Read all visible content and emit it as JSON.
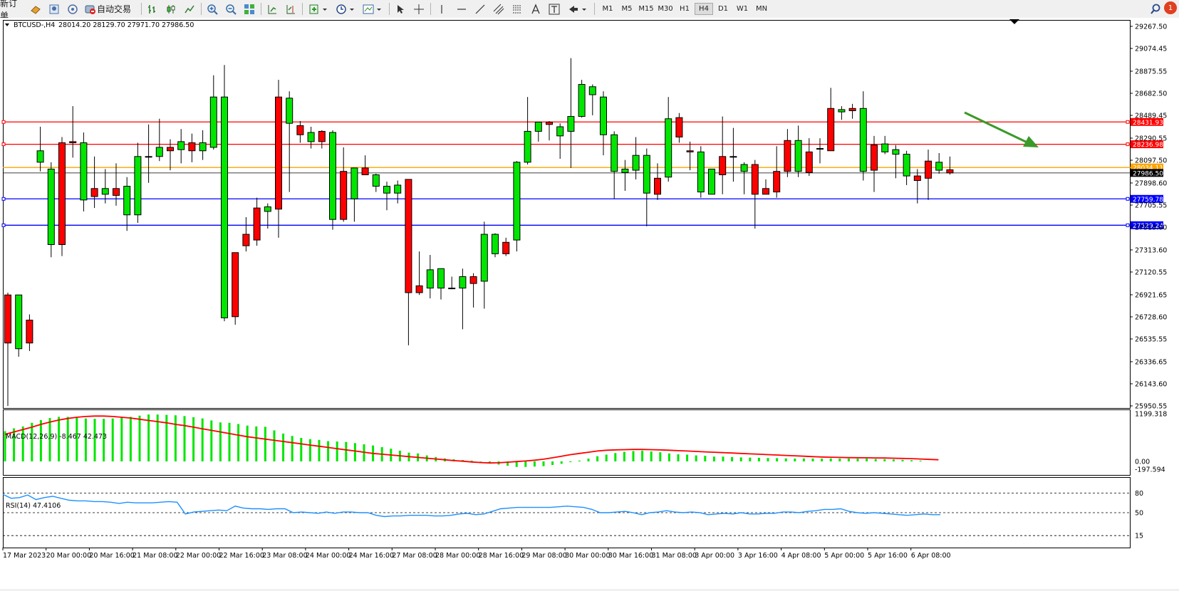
{
  "toolbar": {
    "new_order_label": "新订单",
    "auto_trading_label": "自动交易",
    "timeframes": [
      "M1",
      "M5",
      "M15",
      "M30",
      "H1",
      "H4",
      "D1",
      "W1",
      "MN"
    ],
    "active_timeframe": "H4",
    "notification_count": "1",
    "icons": [
      "new-order-icon",
      "metaeditor-icon",
      "market-watch-icon",
      "signals-icon",
      "auto-trading-icon",
      "bar-chart-icon",
      "candlestick-icon",
      "line-chart-icon",
      "zoom-in-icon",
      "zoom-out-icon",
      "tile-windows-icon",
      "auto-scroll-icon",
      "chart-shift-icon",
      "indicators-icon",
      "periods-icon",
      "templates-icon",
      "cursor-icon",
      "crosshair-icon",
      "vertical-line-icon",
      "horizontal-line-icon",
      "trendline-icon",
      "equidistant-channel-icon",
      "fibonacci-icon",
      "text-icon",
      "text-label-icon",
      "arrows-icon",
      "search-icon",
      "notifications-icon"
    ]
  },
  "chart": {
    "header": "BTCUSD-,H4",
    "ohlc": "28014.20 28129.70 27971.70 27986.50",
    "price_ticks": [
      "29267.50",
      "29074.45",
      "28875.55",
      "28682.50",
      "28489.45",
      "28290.55",
      "28097.50",
      "27898.60",
      "27705.55",
      "27513.00",
      "27313.60",
      "27120.55",
      "26921.65",
      "26728.60",
      "26535.55",
      "26336.65",
      "26143.60",
      "25950.55"
    ],
    "date_labels": [
      "17 Mar 2023",
      "20 Mar 00:00",
      "20 Mar 16:00",
      "21 Mar 08:00",
      "22 Mar 00:00",
      "22 Mar 16:00",
      "23 Mar 08:00",
      "24 Mar 00:00",
      "24 Mar 16:00",
      "27 Mar 08:00",
      "28 Mar 00:00",
      "28 Mar 16:00",
      "29 Mar 08:00",
      "30 Mar 00:00",
      "30 Mar 16:00",
      "31 Mar 08:00",
      "3 Apr 00:00",
      "3 Apr 16:00",
      "4 Apr 08:00",
      "5 Apr 00:00",
      "5 Apr 16:00",
      "6 Apr 08:00"
    ],
    "current_price": "27986.50",
    "levels": [
      {
        "price": "28431.93",
        "color": "#ff0000"
      },
      {
        "price": "28236.98",
        "color": "#ff0000"
      },
      {
        "price": "28034.11",
        "color": "#ffa500"
      },
      {
        "price": "27759.78",
        "color": "#0000ff"
      },
      {
        "price": "27529.24",
        "color": "#0000ff"
      }
    ],
    "up_color": "#00e600",
    "down_color": "#ff0000"
  },
  "macd": {
    "label": "MACD(12,26,9) -8.467 42.473",
    "ticks": [
      "1199.318",
      "0.00",
      "-197.594"
    ]
  },
  "rsi": {
    "label": "RSI(14) 47.4106",
    "ticks": [
      "80",
      "50",
      "15"
    ]
  },
  "chart_data": [
    {
      "type": "candlestick",
      "title": "BTCUSD-,H4",
      "ylim": [
        25950.55,
        29267.5
      ],
      "candles": [
        {
          "o": 26920,
          "h": 26940,
          "l": 25950,
          "c": 26500
        },
        {
          "o": 26450,
          "h": 26920,
          "l": 26380,
          "c": 26920
        },
        {
          "o": 26700,
          "h": 26750,
          "l": 26430,
          "c": 26500
        },
        {
          "o": 28080,
          "h": 28390,
          "l": 28000,
          "c": 28180
        },
        {
          "o": 27360,
          "h": 28080,
          "l": 27250,
          "c": 28020
        },
        {
          "o": 28250,
          "h": 28300,
          "l": 27260,
          "c": 27360
        },
        {
          "o": 28260,
          "h": 28570,
          "l": 28120,
          "c": 28250
        },
        {
          "o": 27750,
          "h": 28340,
          "l": 27650,
          "c": 28250
        },
        {
          "o": 27850,
          "h": 28130,
          "l": 27680,
          "c": 27780
        },
        {
          "o": 27800,
          "h": 28020,
          "l": 27720,
          "c": 27850
        },
        {
          "o": 27850,
          "h": 28070,
          "l": 27700,
          "c": 27790
        },
        {
          "o": 27620,
          "h": 27950,
          "l": 27480,
          "c": 27870
        },
        {
          "o": 27620,
          "h": 28250,
          "l": 27550,
          "c": 28130
        },
        {
          "o": 28130,
          "h": 28410,
          "l": 27900,
          "c": 28130
        },
        {
          "o": 28130,
          "h": 28460,
          "l": 28090,
          "c": 28210
        },
        {
          "o": 28210,
          "h": 28280,
          "l": 28010,
          "c": 28180
        },
        {
          "o": 28190,
          "h": 28370,
          "l": 28070,
          "c": 28260
        },
        {
          "o": 28250,
          "h": 28330,
          "l": 28080,
          "c": 28180
        },
        {
          "o": 28180,
          "h": 28360,
          "l": 28100,
          "c": 28250
        },
        {
          "o": 28210,
          "h": 28840,
          "l": 28190,
          "c": 28650
        },
        {
          "o": 26720,
          "h": 28930,
          "l": 26690,
          "c": 28650
        },
        {
          "o": 27290,
          "h": 27290,
          "l": 26660,
          "c": 26730
        },
        {
          "o": 27450,
          "h": 27600,
          "l": 27300,
          "c": 27350
        },
        {
          "o": 27680,
          "h": 27770,
          "l": 27350,
          "c": 27400
        },
        {
          "o": 27650,
          "h": 27720,
          "l": 27500,
          "c": 27690
        },
        {
          "o": 28650,
          "h": 28800,
          "l": 27420,
          "c": 27670
        },
        {
          "o": 28420,
          "h": 28700,
          "l": 27820,
          "c": 28640
        },
        {
          "o": 28400,
          "h": 28440,
          "l": 28250,
          "c": 28320
        },
        {
          "o": 28260,
          "h": 28390,
          "l": 28200,
          "c": 28340
        },
        {
          "o": 28350,
          "h": 28360,
          "l": 28200,
          "c": 28260
        },
        {
          "o": 27580,
          "h": 28360,
          "l": 27490,
          "c": 28340
        },
        {
          "o": 28000,
          "h": 28210,
          "l": 27560,
          "c": 27580
        },
        {
          "o": 27760,
          "h": 28000,
          "l": 27560,
          "c": 28030
        },
        {
          "o": 28030,
          "h": 28140,
          "l": 27980,
          "c": 27970
        },
        {
          "o": 27870,
          "h": 27980,
          "l": 27820,
          "c": 27970
        },
        {
          "o": 27810,
          "h": 27910,
          "l": 27660,
          "c": 27870
        },
        {
          "o": 27810,
          "h": 27920,
          "l": 27720,
          "c": 27880
        },
        {
          "o": 27930,
          "h": 27930,
          "l": 26480,
          "c": 26940
        },
        {
          "o": 27000,
          "h": 27300,
          "l": 26920,
          "c": 26940
        },
        {
          "o": 26980,
          "h": 27270,
          "l": 26890,
          "c": 27140
        },
        {
          "o": 26980,
          "h": 27140,
          "l": 26880,
          "c": 27150
        },
        {
          "o": 26980,
          "h": 27080,
          "l": 26970,
          "c": 26980
        },
        {
          "o": 26980,
          "h": 27150,
          "l": 26620,
          "c": 27080
        },
        {
          "o": 27080,
          "h": 27110,
          "l": 26810,
          "c": 27020
        },
        {
          "o": 27040,
          "h": 27560,
          "l": 26800,
          "c": 27450
        },
        {
          "o": 27280,
          "h": 27460,
          "l": 27250,
          "c": 27450
        },
        {
          "o": 27380,
          "h": 27420,
          "l": 27260,
          "c": 27280
        },
        {
          "o": 27400,
          "h": 28090,
          "l": 27300,
          "c": 28080
        },
        {
          "o": 28080,
          "h": 28650,
          "l": 28060,
          "c": 28350
        },
        {
          "o": 28350,
          "h": 28430,
          "l": 28260,
          "c": 28430
        },
        {
          "o": 28430,
          "h": 28440,
          "l": 28270,
          "c": 28410
        },
        {
          "o": 28310,
          "h": 28420,
          "l": 28110,
          "c": 28390
        },
        {
          "o": 28350,
          "h": 28990,
          "l": 28030,
          "c": 28480
        },
        {
          "o": 28480,
          "h": 28800,
          "l": 28470,
          "c": 28760
        },
        {
          "o": 28670,
          "h": 28760,
          "l": 28490,
          "c": 28740
        },
        {
          "o": 28320,
          "h": 28700,
          "l": 28140,
          "c": 28650
        },
        {
          "o": 28000,
          "h": 28350,
          "l": 27760,
          "c": 28320
        },
        {
          "o": 27990,
          "h": 28100,
          "l": 27830,
          "c": 28020
        },
        {
          "o": 28010,
          "h": 28300,
          "l": 27930,
          "c": 28140
        },
        {
          "o": 27810,
          "h": 28200,
          "l": 27520,
          "c": 28140
        },
        {
          "o": 27940,
          "h": 28070,
          "l": 27750,
          "c": 27800
        },
        {
          "o": 27950,
          "h": 28650,
          "l": 27910,
          "c": 28460
        },
        {
          "o": 28470,
          "h": 28510,
          "l": 28250,
          "c": 28300
        },
        {
          "o": 28180,
          "h": 28260,
          "l": 28010,
          "c": 28170
        },
        {
          "o": 27820,
          "h": 28220,
          "l": 27770,
          "c": 28170
        },
        {
          "o": 27800,
          "h": 28020,
          "l": 27810,
          "c": 28020
        },
        {
          "o": 28130,
          "h": 28480,
          "l": 27800,
          "c": 27970
        },
        {
          "o": 28130,
          "h": 28380,
          "l": 27910,
          "c": 28130
        },
        {
          "o": 28000,
          "h": 28080,
          "l": 27800,
          "c": 28060
        },
        {
          "o": 28060,
          "h": 28100,
          "l": 27500,
          "c": 27800
        },
        {
          "o": 27850,
          "h": 27930,
          "l": 27800,
          "c": 27800
        },
        {
          "o": 28000,
          "h": 28220,
          "l": 27770,
          "c": 27820
        },
        {
          "o": 28270,
          "h": 28370,
          "l": 27950,
          "c": 28000
        },
        {
          "o": 28000,
          "h": 28400,
          "l": 27950,
          "c": 28270
        },
        {
          "o": 28170,
          "h": 28290,
          "l": 27960,
          "c": 27990
        },
        {
          "o": 28200,
          "h": 28290,
          "l": 28070,
          "c": 28200
        },
        {
          "o": 28550,
          "h": 28730,
          "l": 28180,
          "c": 28180
        },
        {
          "o": 28520,
          "h": 28570,
          "l": 28450,
          "c": 28540
        },
        {
          "o": 28550,
          "h": 28590,
          "l": 28460,
          "c": 28530
        },
        {
          "o": 28000,
          "h": 28700,
          "l": 27920,
          "c": 28550
        },
        {
          "o": 28230,
          "h": 28310,
          "l": 27820,
          "c": 28010
        },
        {
          "o": 28170,
          "h": 28310,
          "l": 28150,
          "c": 28240
        },
        {
          "o": 28150,
          "h": 28230,
          "l": 27940,
          "c": 28190
        },
        {
          "o": 27960,
          "h": 28180,
          "l": 27880,
          "c": 28150
        },
        {
          "o": 27960,
          "h": 28020,
          "l": 27720,
          "c": 27920
        },
        {
          "o": 28090,
          "h": 28190,
          "l": 27750,
          "c": 27940
        },
        {
          "o": 28010,
          "h": 28160,
          "l": 27980,
          "c": 28080
        },
        {
          "o": 28014.2,
          "h": 28129.7,
          "l": 27971.7,
          "c": 27986.5
        }
      ]
    },
    {
      "type": "bar",
      "title": "MACD(12,26,9) -8.467 42.473",
      "ylim": [
        -197.594,
        1199.318
      ],
      "histogram": [
        760,
        830,
        880,
        970,
        1040,
        1090,
        1120,
        1120,
        1100,
        1080,
        1070,
        1070,
        1080,
        1100,
        1120,
        1150,
        1180,
        1180,
        1170,
        1160,
        1140,
        1110,
        1080,
        1030,
        980,
        970,
        940,
        900,
        880,
        870,
        780,
        700,
        640,
        590,
        560,
        540,
        510,
        500,
        490,
        460,
        430,
        400,
        360,
        320,
        270,
        220,
        200,
        150,
        110,
        75,
        55,
        35,
        20,
        -10,
        -40,
        -80,
        -110,
        -140,
        -140,
        -130,
        -120,
        -90,
        -60,
        -20,
        20,
        70,
        130,
        170,
        210,
        240,
        260,
        270,
        250,
        230,
        200,
        180,
        170,
        150,
        140,
        120,
        120,
        110,
        100,
        95,
        90,
        85,
        80,
        75,
        70,
        75,
        72,
        70,
        74,
        72,
        70,
        68,
        70,
        60,
        55,
        50,
        40,
        30,
        20,
        0
      ],
      "signal": [
        680,
        740,
        800,
        860,
        930,
        990,
        1040,
        1080,
        1110,
        1130,
        1140,
        1140,
        1130,
        1110,
        1090,
        1060,
        1030,
        1000,
        970,
        930,
        900,
        860,
        820,
        780,
        740,
        700,
        660,
        620,
        590,
        560,
        530,
        500,
        470,
        440,
        410,
        380,
        350,
        320,
        290,
        260,
        230,
        200,
        180,
        160,
        140,
        120,
        100,
        80,
        60,
        40,
        20,
        5,
        -15,
        -30,
        -40,
        -35,
        -20,
        -5,
        10,
        30,
        55,
        90,
        130,
        170,
        200,
        230,
        260,
        280,
        290,
        295,
        300,
        300,
        295,
        290,
        280,
        270,
        260,
        250,
        240,
        230,
        220,
        210,
        200,
        190,
        180,
        170,
        160,
        150,
        140,
        130,
        120,
        110,
        105,
        100,
        95,
        92,
        90,
        88,
        85,
        80,
        75,
        70,
        60,
        50,
        40
      ]
    },
    {
      "type": "line",
      "title": "RSI(14) 47.4106",
      "ylim": [
        0,
        100
      ],
      "values": [
        78,
        72,
        73,
        77,
        70,
        73,
        75,
        72,
        69,
        68,
        68,
        67,
        67,
        66,
        64,
        66,
        65,
        65,
        65,
        66,
        67,
        66,
        48,
        51,
        52,
        53,
        54,
        53,
        60,
        57,
        56,
        56,
        55,
        56,
        56,
        50,
        51,
        50,
        49,
        51,
        49,
        51,
        51,
        50,
        50,
        46,
        44,
        45,
        45,
        46,
        46,
        46,
        45,
        45,
        46,
        48,
        49,
        47,
        48,
        52,
        56,
        57,
        58,
        58,
        58,
        58,
        58,
        59,
        60,
        59,
        58,
        55,
        50,
        50,
        51,
        52,
        50,
        47,
        50,
        51,
        53,
        51,
        50,
        51,
        50,
        47,
        48,
        49,
        48,
        50,
        48,
        48,
        49,
        49,
        51,
        51,
        50,
        52,
        53,
        55,
        55,
        56,
        52,
        50,
        49,
        50,
        49,
        48,
        47,
        46,
        47,
        48,
        47,
        47
      ]
    }
  ]
}
